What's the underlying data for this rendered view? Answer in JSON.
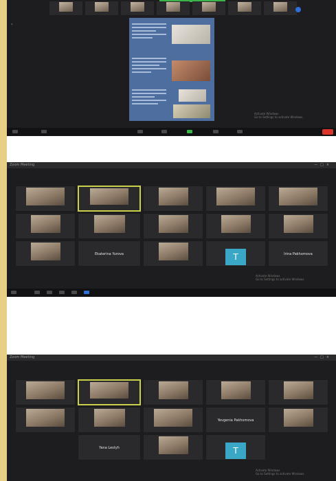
{
  "screens": [
    {
      "id": "zoom-presentation",
      "titlebar": {
        "title": ""
      },
      "top_strip": [
        {
          "name": ""
        },
        {
          "name": ""
        },
        {
          "name": ""
        },
        {
          "name": ""
        },
        {
          "name": ""
        },
        {
          "name": ""
        },
        {
          "name": ""
        }
      ],
      "notice": {
        "line1": "Activate Windows",
        "line2": "Go to Settings to activate Windows."
      }
    },
    {
      "id": "zoom-gallery-1",
      "titlebar": {
        "title": "Zoom Meeting"
      },
      "tiles": [
        {
          "name": ""
        },
        {
          "name": "",
          "active": true
        },
        {
          "name": ""
        },
        {
          "name": ""
        },
        {
          "name": ""
        },
        {
          "name": ""
        },
        {
          "name": ""
        },
        {
          "name": ""
        },
        {
          "name": ""
        },
        {
          "name": ""
        },
        {
          "name": ""
        },
        {
          "center_name": "Ekaterina Yurova"
        },
        {
          "name": ""
        },
        {
          "avatar": "T",
          "name": ""
        },
        {
          "center_name": "Irina Pakhomova"
        }
      ],
      "notice": {
        "line1": "Activate Windows",
        "line2": "Go to Settings to activate Windows."
      }
    },
    {
      "id": "zoom-gallery-2",
      "titlebar": {
        "title": "Zoom Meeting"
      },
      "tiles": [
        {
          "name": ""
        },
        {
          "name": "",
          "active": true
        },
        {
          "name": ""
        },
        {
          "name": ""
        },
        {
          "name": ""
        },
        {
          "name": ""
        },
        {
          "name": ""
        },
        {
          "name": ""
        },
        {
          "center_name": "Yevgenia Pakhomova"
        },
        {
          "name": ""
        },
        {
          "center_name": "Yana Lestyh"
        },
        {
          "name": ""
        },
        {
          "avatar": "T",
          "name": ""
        }
      ],
      "notice": {
        "line1": "Activate Windows",
        "line2": "Go to Settings to activate Windows."
      }
    }
  ],
  "colors": {
    "window_bg": "#1d1d1f",
    "active_speaker_border": "#c9d24a",
    "slide_bg": "#4f6ea0",
    "end_button": "#d9352b",
    "avatar_bg": "#3aa7c6"
  }
}
